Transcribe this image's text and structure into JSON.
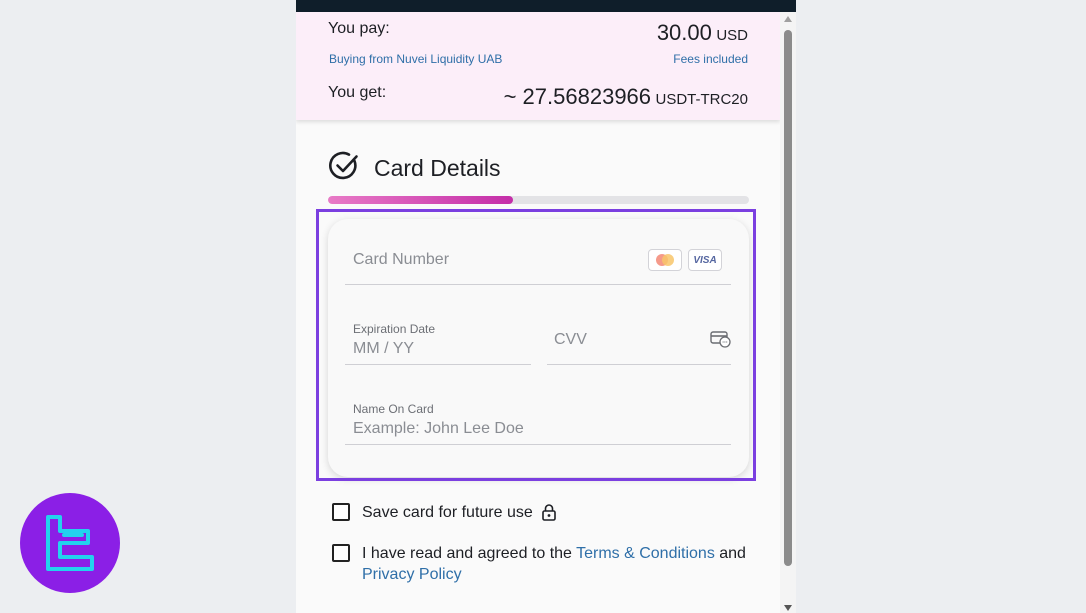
{
  "summary": {
    "pay_label": "You pay:",
    "pay_amount": "30.00",
    "pay_currency": "USD",
    "provider": "Buying from Nuvei Liquidity UAB",
    "fees": "Fees included",
    "get_label": "You get:",
    "get_amount": "~ 27.56823966",
    "get_currency": "USDT-TRC20"
  },
  "section": {
    "title": "Card Details",
    "progress_fraction": 0.44
  },
  "form": {
    "card_number_placeholder": "Card Number",
    "card_brand_visa": "VISA",
    "expiry_label": "Expiration Date",
    "expiry_placeholder": "MM / YY",
    "cvv_placeholder": "CVV",
    "name_label": "Name On Card",
    "name_placeholder": "Example: John Lee Doe"
  },
  "options": {
    "save_card": "Save card for future use",
    "terms_prefix": "I have read and agreed to the ",
    "terms_link": "Terms & Conditions",
    "terms_and": " and",
    "privacy_link": "Privacy Policy"
  },
  "colors": {
    "accent": "#c42ea8",
    "highlight": "#7b3fe0",
    "link": "#2f6fa8",
    "logo_bg": "#8b1fe6",
    "logo_mark": "#22d3ee"
  }
}
